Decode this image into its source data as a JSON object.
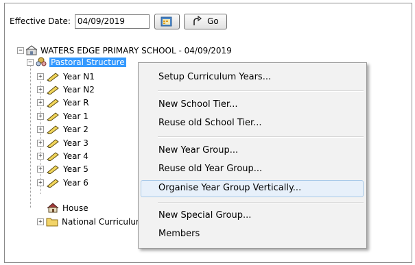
{
  "toolbar": {
    "effective_date_label": "Effective Date:",
    "effective_date_value": "04/09/2019",
    "calendar_icon": "calendar-icon",
    "go_label": "Go",
    "go_icon": "arrow-go-icon"
  },
  "tree": {
    "root": {
      "label": "WATERS EDGE PRIMARY SCHOOL - 04/09/2019",
      "expander": "−"
    },
    "pastoral": {
      "label": "Pastoral Structure",
      "expander": "−"
    },
    "years": [
      {
        "label": "Year N1",
        "expander": "+"
      },
      {
        "label": "Year N2",
        "expander": "+"
      },
      {
        "label": "Year R",
        "expander": "+"
      },
      {
        "label": "Year 1",
        "expander": "+"
      },
      {
        "label": "Year 2",
        "expander": "+"
      },
      {
        "label": "Year 3",
        "expander": "+"
      },
      {
        "label": "Year 4",
        "expander": "+"
      },
      {
        "label": "Year 5",
        "expander": "+"
      },
      {
        "label": "Year 6",
        "expander": "+"
      }
    ],
    "house": {
      "label": "House"
    },
    "national": {
      "label": "National Curriculum",
      "expander": "+"
    }
  },
  "context_menu": {
    "items": [
      {
        "label": "Setup Curriculum Years..."
      },
      {
        "label": "New School Tier..."
      },
      {
        "label": "Reuse old School Tier..."
      },
      {
        "label": "New Year Group..."
      },
      {
        "label": "Reuse old Year Group..."
      },
      {
        "label": "Organise Year Group Vertically...",
        "highlighted": true
      },
      {
        "label": "New Special Group..."
      },
      {
        "label": "Members"
      }
    ]
  }
}
